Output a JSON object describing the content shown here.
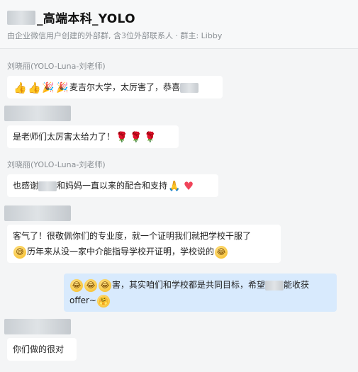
{
  "header": {
    "title": "_高端本科_YOLO",
    "subtitle": "由企业微信用户创建的外部群, 含3位外部联系人 · 群主: Libby"
  },
  "messages": [
    {
      "sender": "刘晓丽(YOLO-Luna-刘老师)",
      "text": "麦吉尔大学，太厉害了，恭喜"
    },
    {
      "sender": "",
      "text": "是老师们太厉害太给力了！"
    },
    {
      "sender": "刘晓丽(YOLO-Luna-刘老师)",
      "text_a": "也感谢",
      "text_b": "和妈妈一直以来的配合和支持"
    },
    {
      "sender": "",
      "line1": "客气了！很敬佩你们的专业度，就一个证明我们就把学校干服了",
      "line2": "历年来从没一家中介能指导学校开证明，学校说的"
    },
    {
      "sender": "",
      "line1_a": "害，其实咱们和学校都是共同目标，希望",
      "line1_b": "能收获",
      "line2": "offer~"
    },
    {
      "sender": "",
      "text": "你们做的很对"
    }
  ],
  "icons": [
    "thumbs-up-icon",
    "party-popper-icon",
    "rose-icon",
    "folded-hands-icon",
    "heart-icon",
    "grin-sweat-icon",
    "tears-of-joy-icon",
    "hug-face-icon"
  ]
}
